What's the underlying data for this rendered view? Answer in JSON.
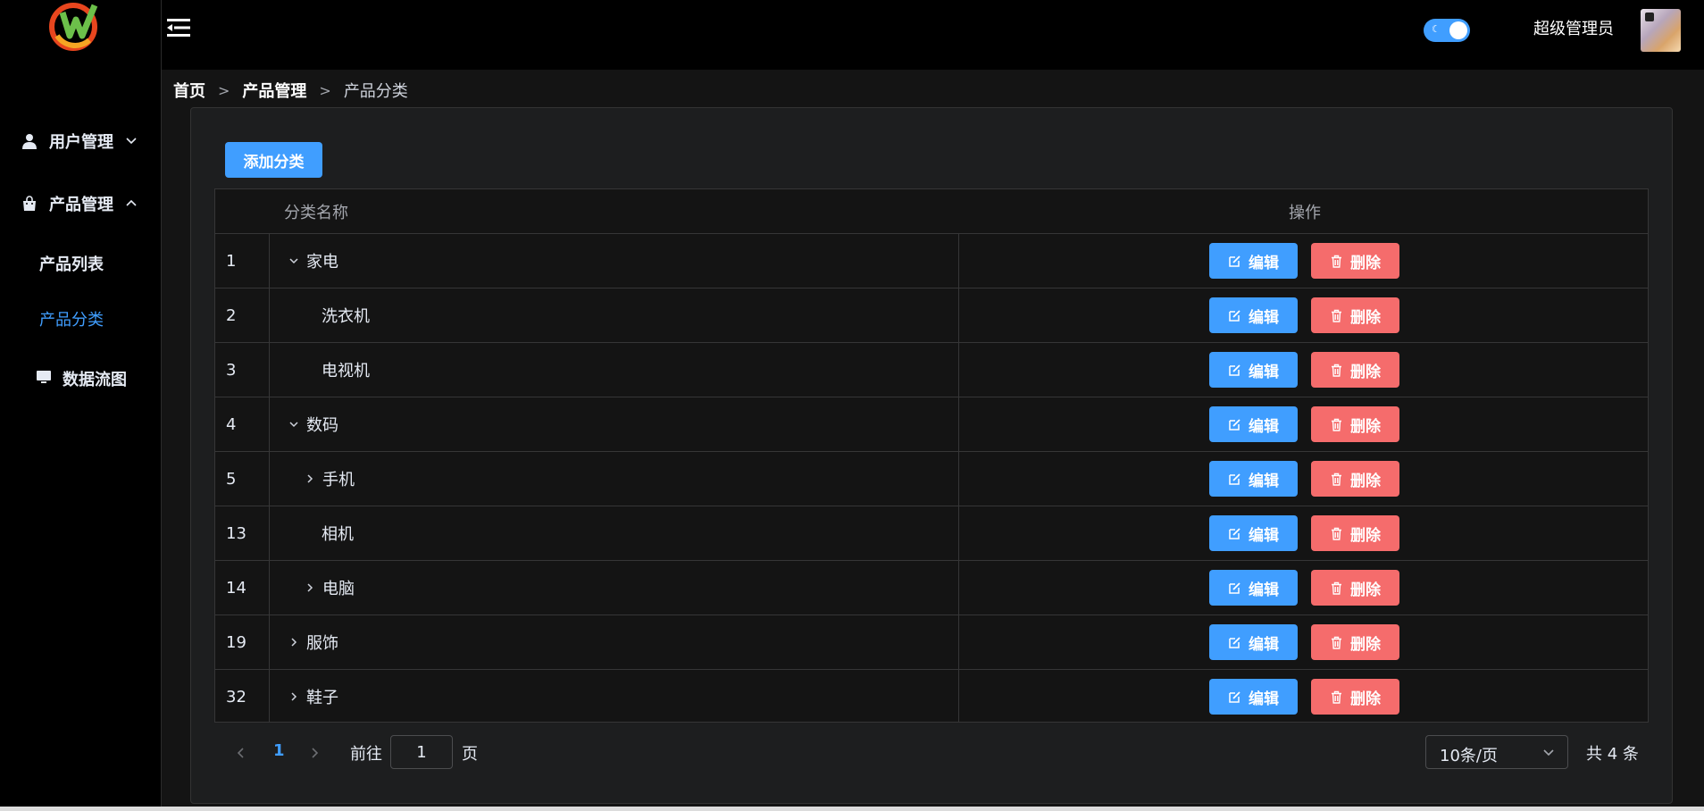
{
  "header": {
    "user_name": "超级管理员"
  },
  "sidebar": {
    "groups": [
      {
        "label": "用户管理"
      },
      {
        "label": "产品管理"
      },
      {
        "label": "数据流图"
      }
    ],
    "sub_items": [
      {
        "label": "产品列表"
      },
      {
        "label": "产品分类"
      }
    ]
  },
  "breadcrumb": [
    "首页",
    "产品管理",
    "产品分类"
  ],
  "breadcrumb_sep": ">",
  "toolbar": {
    "add_label": "添加分类"
  },
  "table": {
    "headers": [
      "分类名称",
      "操作"
    ],
    "edit_label": "编辑",
    "delete_label": "删除",
    "rows": [
      {
        "id": "1",
        "name": "家电",
        "expander": "expanded"
      },
      {
        "id": "2",
        "name": "洗衣机",
        "expander": "none"
      },
      {
        "id": "3",
        "name": "电视机",
        "expander": "none"
      },
      {
        "id": "4",
        "name": "数码",
        "expander": "expanded"
      },
      {
        "id": "5",
        "name": "手机",
        "expander": "collapsed"
      },
      {
        "id": "13",
        "name": "相机",
        "expander": "none"
      },
      {
        "id": "14",
        "name": "电脑",
        "expander": "collapsed"
      },
      {
        "id": "19",
        "name": "服饰",
        "expander": "collapsed"
      },
      {
        "id": "32",
        "name": "鞋子",
        "expander": "collapsed"
      }
    ]
  },
  "pagination": {
    "current_page": "1",
    "goto_prefix": "前往",
    "goto_value": "1",
    "goto_suffix": "页",
    "page_size": "10条/页",
    "total": "共 4 条"
  },
  "colors": {
    "primary": "#409eff",
    "danger": "#f56c6c",
    "background": "#141414",
    "header": "#000000"
  }
}
